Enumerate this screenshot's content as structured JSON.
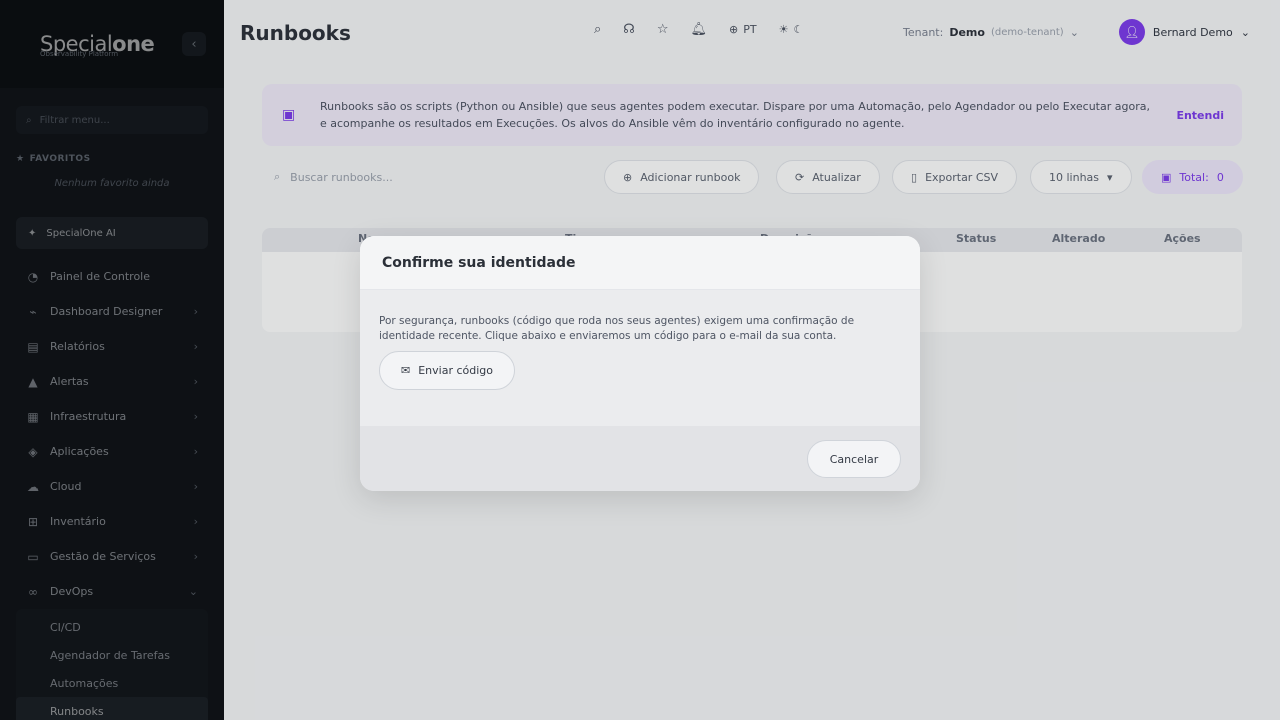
{
  "sidebar": {
    "brand": {
      "logo_regular": "Special",
      "logo_bold": "one",
      "tagline": "Observability Platform"
    },
    "collapse_icon": "‹",
    "menu_filter_placeholder": "Filtrar menu...",
    "favorites_title": "FAVORITOS",
    "favorites_empty": "Nenhum favorito ainda",
    "ai_label": "SpecialOne AI",
    "items": [
      {
        "label": "Painel de Controle",
        "icon": "◔",
        "chevron": ""
      },
      {
        "label": "Dashboard Designer",
        "icon": "⌁",
        "chevron": "›"
      },
      {
        "label": "Relatórios",
        "icon": "▤",
        "chevron": "›"
      },
      {
        "label": "Alertas",
        "icon": "▲",
        "chevron": "›"
      },
      {
        "label": "Infraestrutura",
        "icon": "▦",
        "chevron": "›"
      },
      {
        "label": "Aplicações",
        "icon": "◈",
        "chevron": "›"
      },
      {
        "label": "Cloud",
        "icon": "☁",
        "chevron": "›"
      },
      {
        "label": "Inventário",
        "icon": "⊞",
        "chevron": "›"
      },
      {
        "label": "Gestão de Serviços",
        "icon": "▭",
        "chevron": "›"
      },
      {
        "label": "DevOps",
        "icon": "∞",
        "chevron": "⌄"
      }
    ],
    "sub_items": [
      {
        "label": "CI/CD"
      },
      {
        "label": "Agendador de Tarefas"
      },
      {
        "label": "Automações"
      },
      {
        "label": "Runbooks"
      }
    ]
  },
  "header": {
    "title": "Runbooks",
    "lang": "PT",
    "tenant_label": "Tenant:",
    "tenant_name": "Demo",
    "tenant_id": "(demo-tenant)",
    "user_name": "Bernard Demo"
  },
  "banner": {
    "text": "Runbooks são os scripts (Python ou Ansible) que seus agentes podem executar. Dispare por uma Automação, pelo Agendador ou pelo Executar agora, e acompanhe os resultados em Execuções. Os alvos do Ansible vêm do inventário configurado no agente.",
    "button": "Entendi"
  },
  "toolbar": {
    "search_placeholder": "Buscar runbooks...",
    "add": "Adicionar runbook",
    "refresh": "Atualizar",
    "export": "Exportar CSV",
    "rows": "10 linhas",
    "total_label": "Total:",
    "total_value": "0"
  },
  "table": {
    "columns": [
      "Nome",
      "Tipo",
      "Descrição",
      "Status",
      "Alterado",
      "Ações"
    ]
  },
  "modal": {
    "title": "Confirme sua identidade",
    "body": "Por segurança, runbooks (código que roda nos seus agentes) exigem uma confirmação de identidade recente. Clique abaixo e enviaremos um código para o e-mail da sua conta.",
    "send_button": "Enviar código",
    "cancel_button": "Cancelar"
  }
}
